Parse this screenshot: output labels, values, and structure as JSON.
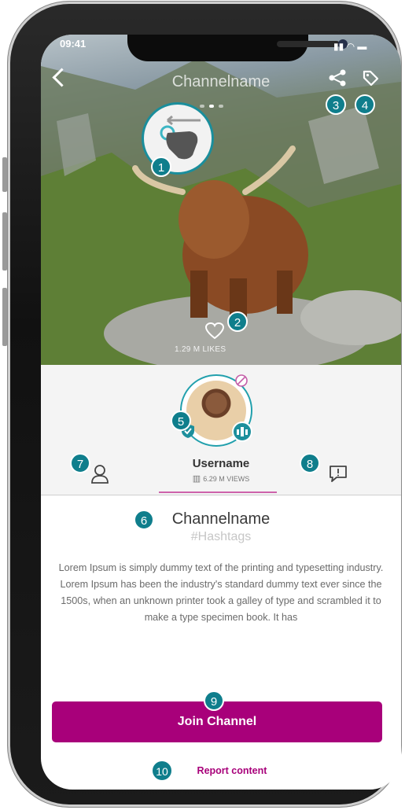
{
  "status": {
    "time": "09:41"
  },
  "header": {
    "title": "Channelname"
  },
  "hero": {
    "likes": "1.29 M LIKES"
  },
  "profile": {
    "username": "Username",
    "views": "6.29 M VIEWS"
  },
  "channel": {
    "name": "Channelname",
    "hashtags": "#Hashtags",
    "description": "Lorem Ipsum is simply dummy text of the printing and typesetting industry. Lorem Ipsum has been the industry's standard dummy text ever since the 1500s, when an unknown printer took a galley of type and scrambled it to make a type specimen book. It has"
  },
  "actions": {
    "join_label": "Join Channel",
    "report_label": "Report content"
  },
  "markers": [
    "1",
    "2",
    "3",
    "4",
    "5",
    "6",
    "7",
    "8",
    "9",
    "10"
  ],
  "colors": {
    "accent": "#a8007a",
    "teal": "#0f7e8c"
  }
}
